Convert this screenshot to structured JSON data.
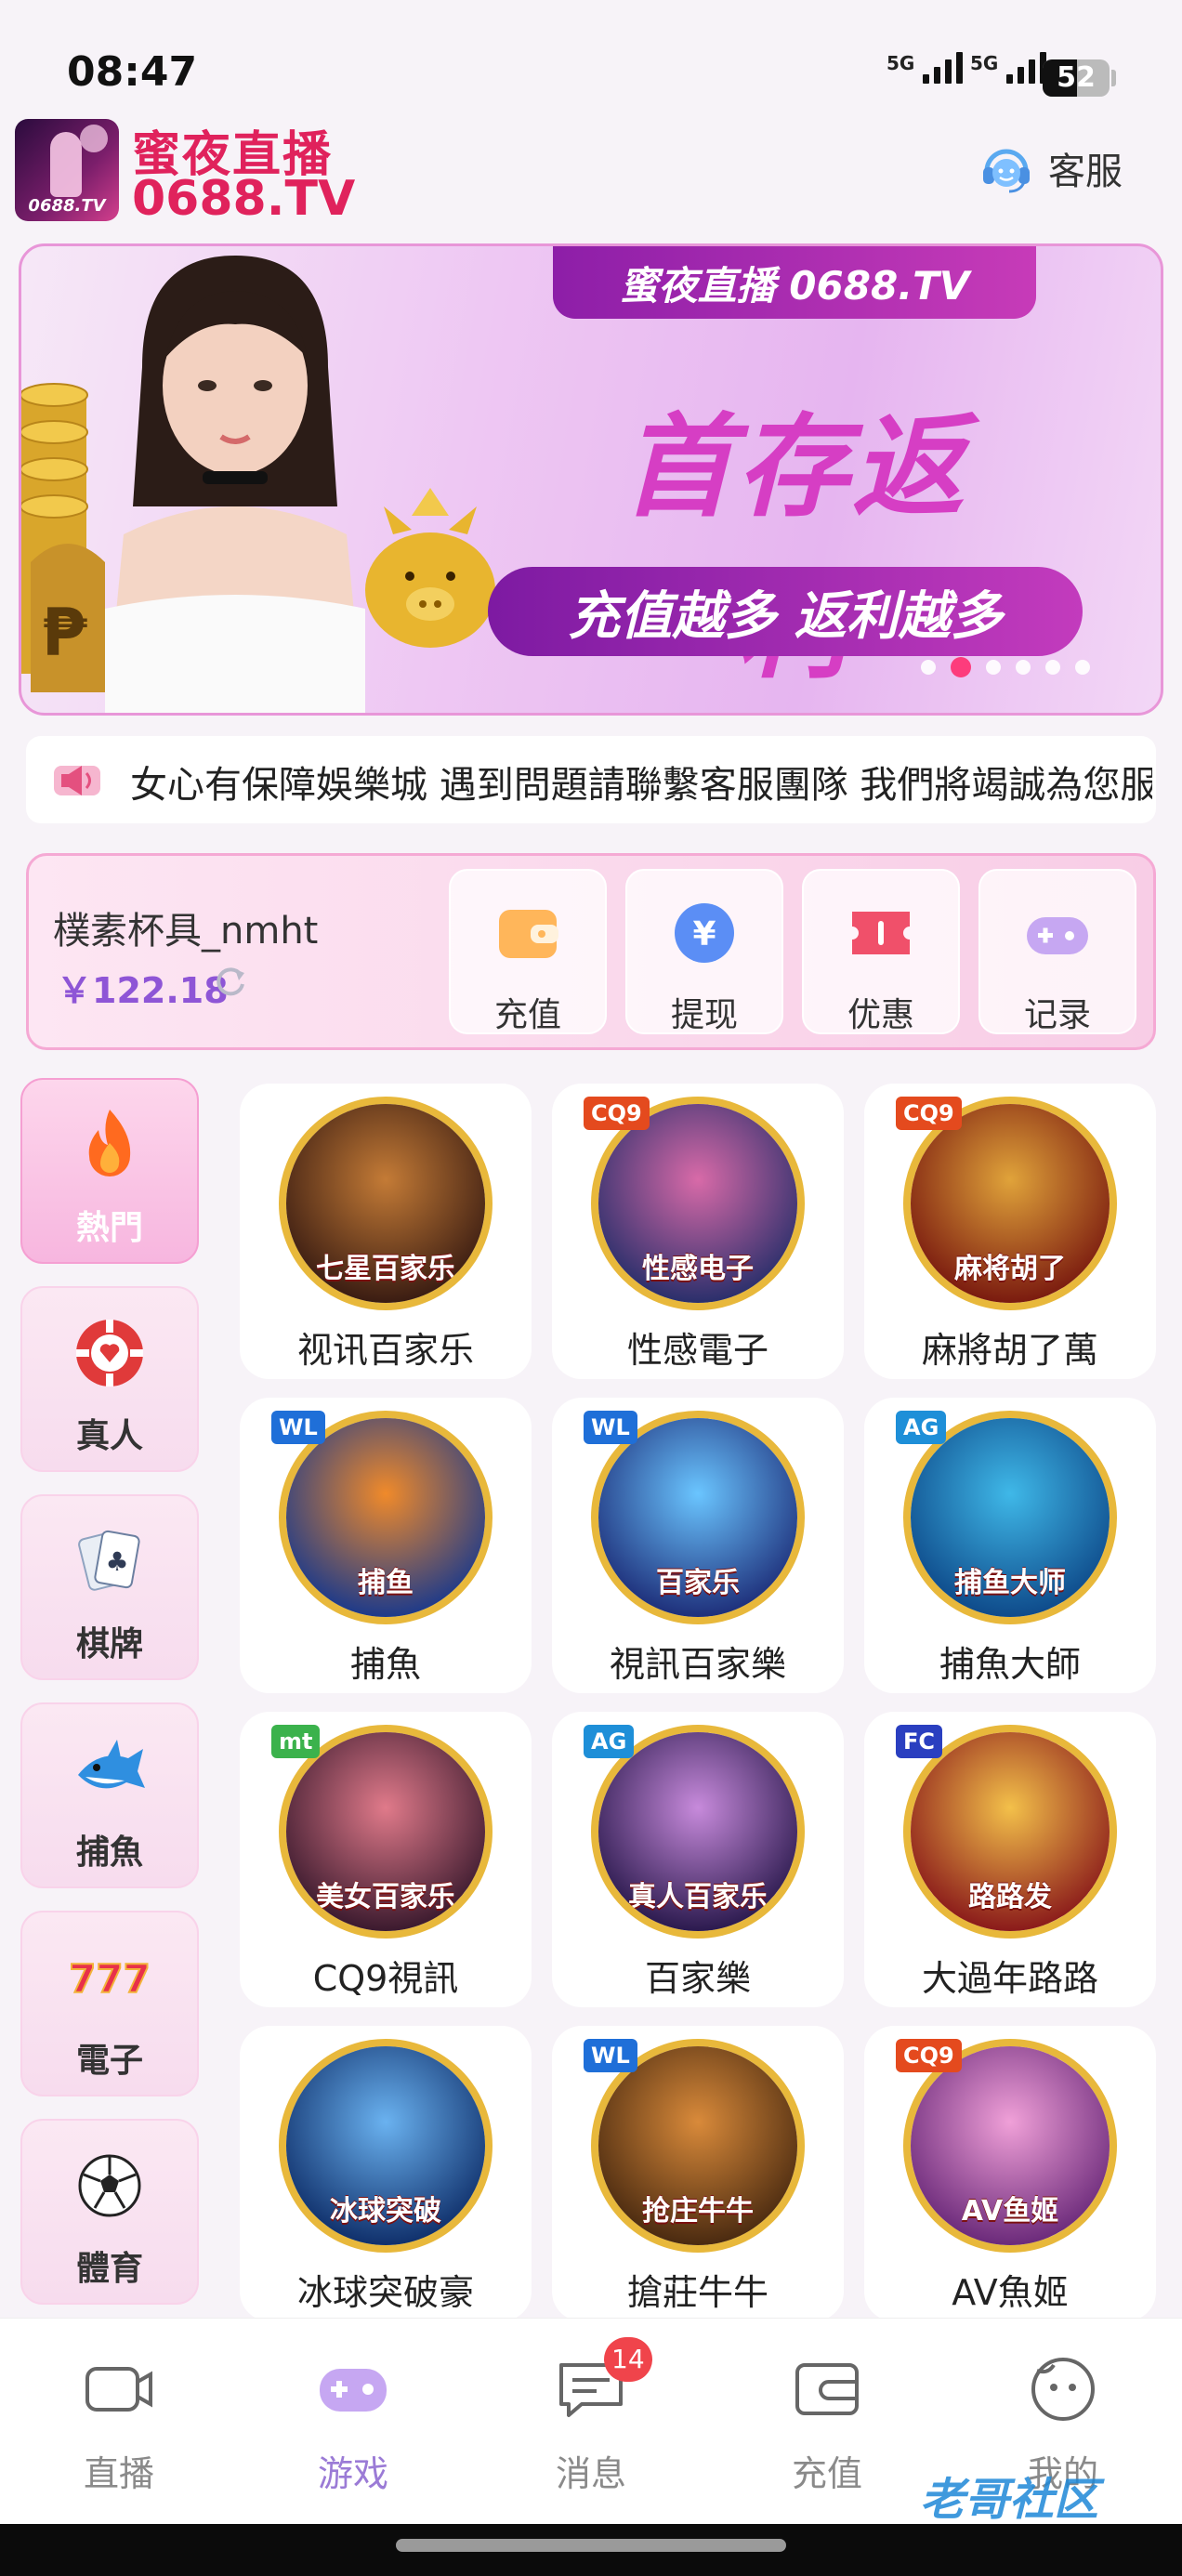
{
  "status_bar": {
    "time": "08:47",
    "signal1_label": "5G",
    "signal2_label": "5G",
    "battery": "52",
    "battery_level": 0.52
  },
  "header": {
    "logo_tag": "0688.TV",
    "brand_cn": "蜜夜直播",
    "brand_en": "0688.TV",
    "support_label": "客服",
    "support_icon": "headset-icon"
  },
  "banner": {
    "top_label": "蜜夜直播 0688.TV",
    "title": "首存返利",
    "subtitle": "充值越多 返利越多",
    "slide_count": 6,
    "active_slide": 1
  },
  "marquee": {
    "icon": "speaker-icon",
    "text": "女心有保障娛樂城  遇到問題請聯繫客服團隊 我們將竭誠為您服"
  },
  "wallet": {
    "username": "樸素杯具_nmht",
    "balance": "￥122.18",
    "actions": [
      {
        "label": "充值",
        "icon": "wallet-icon"
      },
      {
        "label": "提现",
        "icon": "yen-coin-icon"
      },
      {
        "label": "优惠",
        "icon": "coupon-icon"
      },
      {
        "label": "记录",
        "icon": "gamepad-icon"
      }
    ]
  },
  "categories": [
    {
      "label": "熱門",
      "icon": "flame-icon",
      "active": true
    },
    {
      "label": "真人",
      "icon": "poker-chip-icon"
    },
    {
      "label": "棋牌",
      "icon": "playing-cards-icon"
    },
    {
      "label": "捕魚",
      "icon": "shark-icon"
    },
    {
      "label": "電子",
      "icon": "slot-777-icon"
    },
    {
      "label": "體育",
      "icon": "soccer-ball-icon"
    }
  ],
  "games": [
    {
      "name": "视讯百家乐",
      "art_title": "七星百家乐",
      "brand": ""
    },
    {
      "name": "性感電子",
      "art_title": "性感电子",
      "brand": "CQ9"
    },
    {
      "name": "麻將胡了萬",
      "art_title": "麻将胡了",
      "brand": "CQ9"
    },
    {
      "name": "捕魚",
      "art_title": "捕鱼",
      "brand": "WL"
    },
    {
      "name": "視訊百家樂",
      "art_title": "百家乐",
      "brand": "WL"
    },
    {
      "name": "捕魚大師",
      "art_title": "捕鱼大师",
      "brand": "AG"
    },
    {
      "name": "CQ9視訊",
      "art_title": "美女百家乐",
      "brand": "mt"
    },
    {
      "name": "百家樂",
      "art_title": "真人百家乐",
      "brand": "AG"
    },
    {
      "name": "大過年路路",
      "art_title": "路路发",
      "brand": "FC"
    },
    {
      "name": "冰球突破豪",
      "art_title": "冰球突破",
      "brand": ""
    },
    {
      "name": "搶莊牛牛",
      "art_title": "抢庄牛牛",
      "brand": "WL"
    },
    {
      "name": "AV魚姬",
      "art_title": "AV鱼姬",
      "brand": "CQ9"
    }
  ],
  "tabbar": [
    {
      "label": "直播",
      "icon": "tv-icon"
    },
    {
      "label": "游戏",
      "icon": "gamepad-icon",
      "active": true
    },
    {
      "label": "消息",
      "icon": "message-icon",
      "badge": "14"
    },
    {
      "label": "充值",
      "icon": "wallet-icon"
    },
    {
      "label": "我的",
      "icon": "face-icon"
    }
  ],
  "watermark": "老哥社区",
  "colors": {
    "brand": "#e0225c",
    "accent": "#9b7bd6",
    "pink": "#f7b6df",
    "badge": "#f0444b"
  }
}
